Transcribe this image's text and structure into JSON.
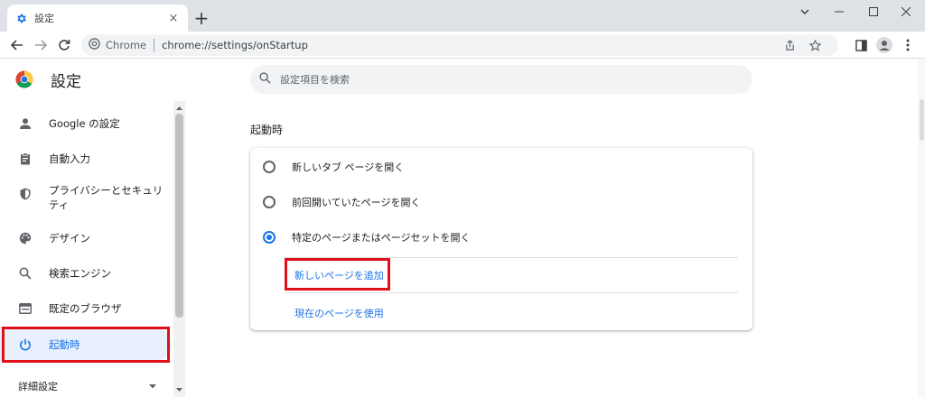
{
  "tab": {
    "title": "設定",
    "close": "×",
    "new_tab": "+"
  },
  "omnibox": {
    "site_label": "Chrome",
    "url": "chrome://settings/onStartup"
  },
  "header": {
    "title": "設定",
    "search_placeholder": "設定項目を検索"
  },
  "sidebar": {
    "items": [
      {
        "label": "Google の設定",
        "icon": "person-icon"
      },
      {
        "label": "自動入力",
        "icon": "clipboard-icon"
      },
      {
        "label": "プライバシーとセキュリティ",
        "icon": "shield-icon"
      },
      {
        "label": "デザイン",
        "icon": "palette-icon"
      },
      {
        "label": "検索エンジン",
        "icon": "search-icon"
      },
      {
        "label": "既定のブラウザ",
        "icon": "browser-icon"
      },
      {
        "label": "起動時",
        "icon": "power-icon",
        "active": true
      }
    ],
    "advanced": "詳細設定"
  },
  "startup": {
    "section_title": "起動時",
    "options": [
      {
        "label": "新しいタブ ページを開く",
        "checked": false
      },
      {
        "label": "前回開いていたページを開く",
        "checked": false
      },
      {
        "label": "特定のページまたはページセットを開く",
        "checked": true
      }
    ],
    "add_page": "新しいページを追加",
    "use_current": "現在のページを使用"
  },
  "colors": {
    "accent": "#1a73e8",
    "highlight": "#e0101a",
    "tabstrip": "#dee1e6"
  }
}
